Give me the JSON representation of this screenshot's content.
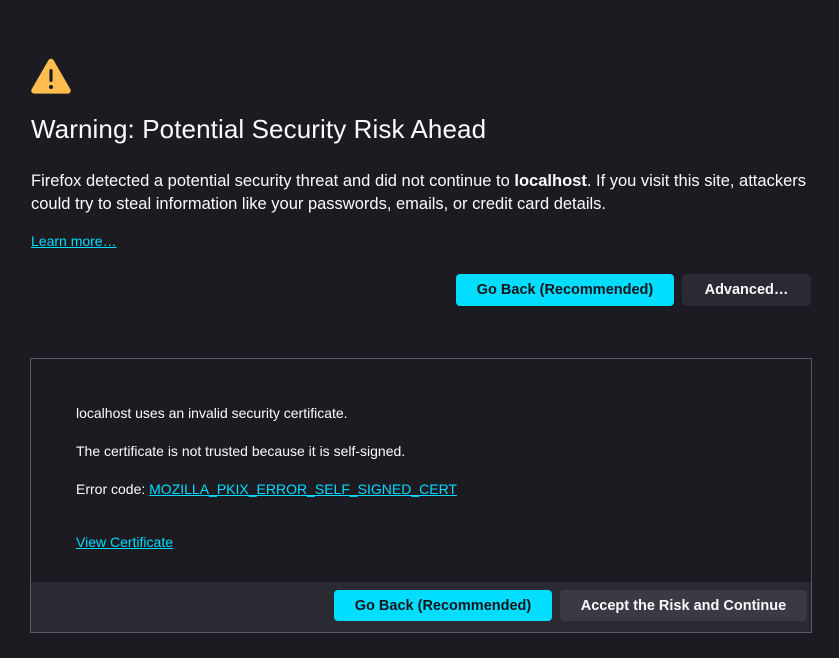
{
  "header": {
    "icon": "warning-triangle-icon",
    "title": "Warning: Potential Security Risk Ahead"
  },
  "description": {
    "before_host": "Firefox detected a potential security threat and did not continue to ",
    "host": "localhost",
    "after_host": ". If you visit this site, attackers could try to steal information like your passwords, emails, or credit card details."
  },
  "learn_more_label": "Learn more…",
  "actions": {
    "go_back_label": "Go Back (Recommended)",
    "advanced_label": "Advanced…"
  },
  "advanced_panel": {
    "invalid_cert_text": "localhost uses an invalid security certificate.",
    "reason_text": "The certificate is not trusted because it is self-signed.",
    "error_code_prefix": "Error code: ",
    "error_code": "MOZILLA_PKIX_ERROR_SELF_SIGNED_CERT",
    "view_certificate_label": "View Certificate",
    "go_back_label": "Go Back (Recommended)",
    "accept_label": "Accept the Risk and Continue"
  },
  "colors": {
    "background": "#1c1b22",
    "accent": "#00ddff",
    "warning": "#ffbd4f",
    "text": "#fbfbfe"
  }
}
